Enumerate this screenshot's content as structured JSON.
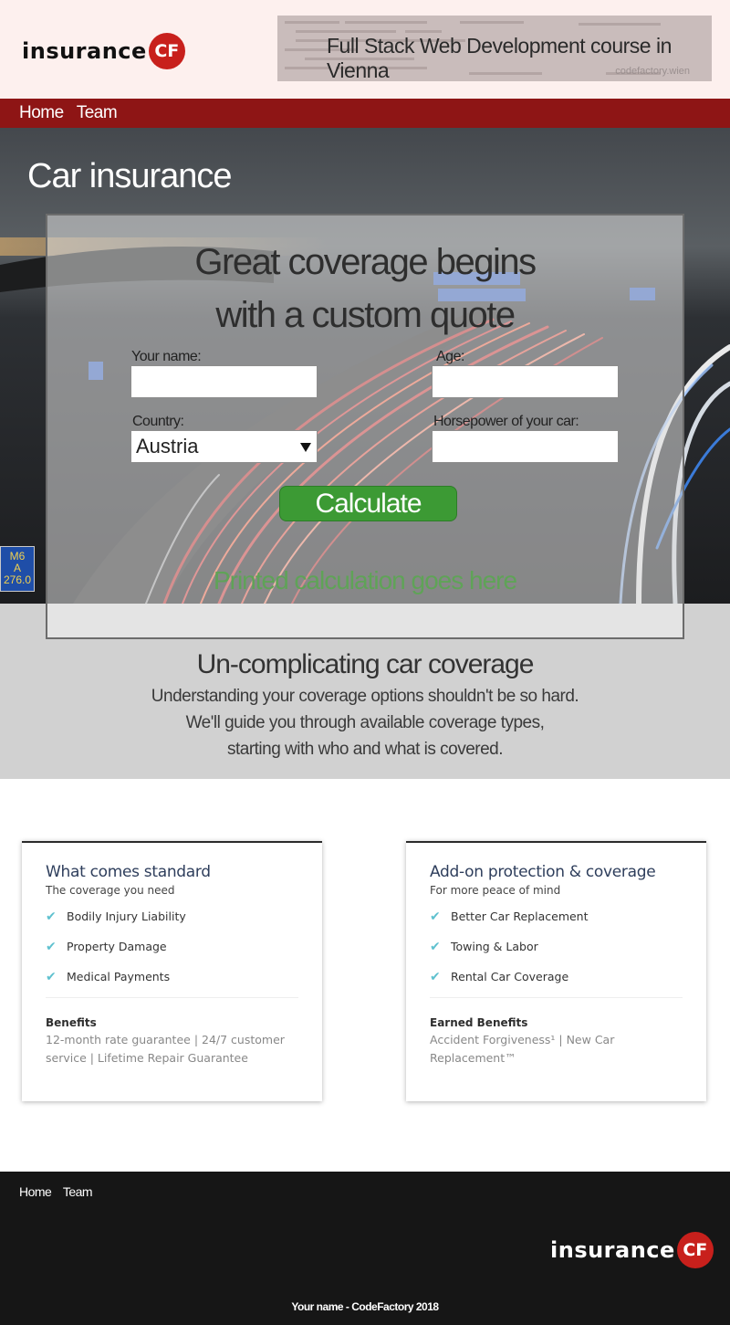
{
  "header": {
    "logo_text": "insurance",
    "logo_badge": "CF",
    "banner_title": "Full Stack Web Development course in Vienna",
    "banner_url": "codefactory.wien"
  },
  "nav": {
    "items": [
      "Home",
      "Team"
    ]
  },
  "hero": {
    "title": "Car insurance",
    "sign_text": [
      "M6",
      "A",
      "276.0"
    ]
  },
  "quote": {
    "title_line1": "Great coverage begins",
    "title_line2": "with a custom quote",
    "name_label": "Your name:",
    "name_value": "",
    "age_label": "Age:",
    "age_value": "",
    "country_label": "Country:",
    "country_value": "Austria",
    "hp_label": "Horsepower of your car:",
    "hp_value": "",
    "calculate_label": "Calculate",
    "result_text": "Printed calculation goes here",
    "result_color": "#5fa357",
    "button_color": "#3c9a34"
  },
  "uncomplicating": {
    "title": "Un-complicating car coverage",
    "line1": "Understanding your coverage options shouldn't be so hard.",
    "line2": "We'll guide you through available coverage types,",
    "line3": "starting with who and what is covered."
  },
  "cards": [
    {
      "title": "What comes standard",
      "subtitle": "The coverage you need",
      "items": [
        "Bodily Injury Liability",
        "Property Damage",
        "Medical Payments"
      ],
      "benefits_title": "Benefits",
      "benefits_text": "12-month rate guarantee | 24/7 customer service | Lifetime Repair Guarantee"
    },
    {
      "title": "Add-on protection & coverage",
      "subtitle": "For more peace of mind",
      "items": [
        "Better Car Replacement",
        "Towing & Labor",
        "Rental Car Coverage"
      ],
      "benefits_title": "Earned Benefits",
      "benefits_text": "Accident Forgiveness¹ | New Car Replacement™"
    }
  ],
  "footer": {
    "nav": [
      "Home",
      "Team"
    ],
    "logo_text": "insurance",
    "logo_badge": "CF",
    "copyright": "Your name - CodeFactory 2018"
  },
  "colors": {
    "header_bg": "#fdf0ee",
    "nav_bg": "#8e1515",
    "brand_red": "#c8201c",
    "check_color": "#5fc1cf",
    "footer_bg": "#161616"
  },
  "icons": [
    "check-icon",
    "chevron-down-icon"
  ]
}
